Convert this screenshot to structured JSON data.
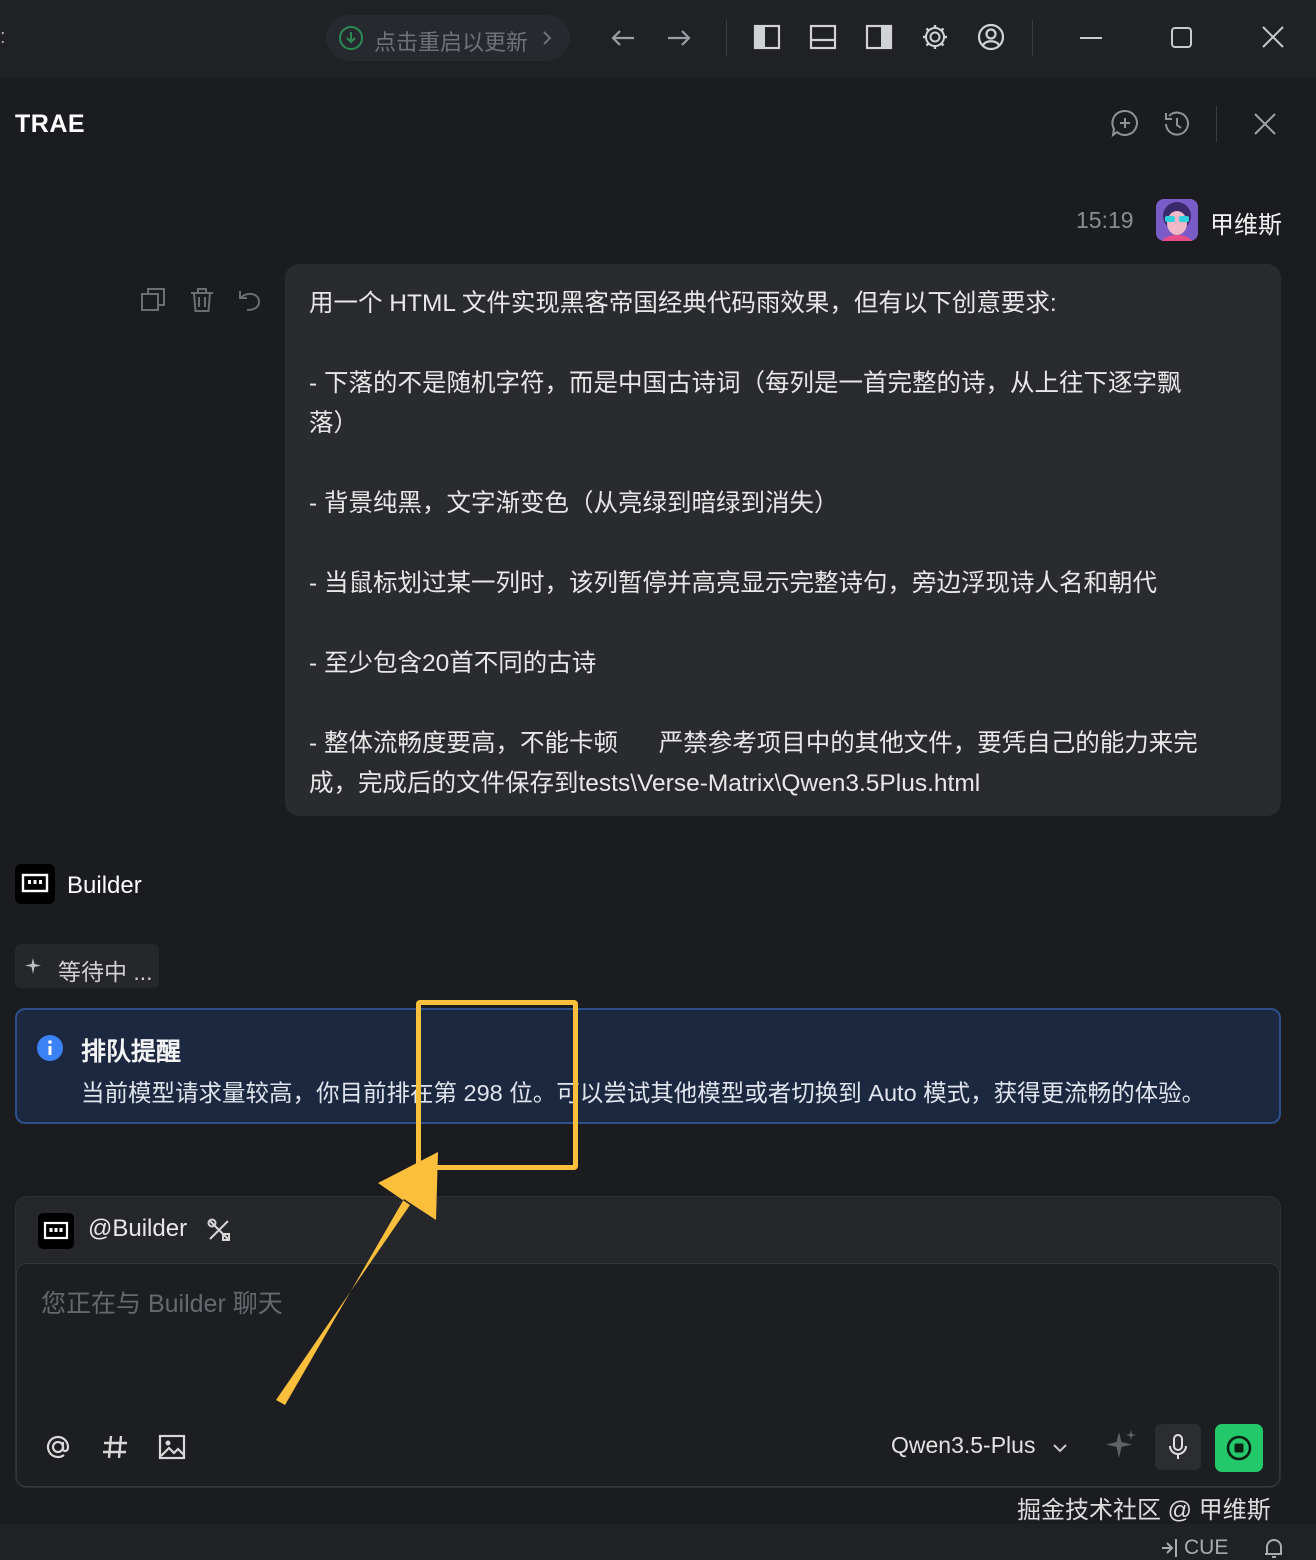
{
  "titlebar": {
    "update_label": "点击重启以更新",
    "icons": [
      "download-icon",
      "back-arrow-icon",
      "forward-arrow-icon",
      "left-panel-icon",
      "bottom-panel-icon",
      "right-panel-icon",
      "gear-icon",
      "account-icon",
      "minimize-icon",
      "maximize-icon",
      "close-icon"
    ]
  },
  "panel": {
    "title": "TRAE",
    "header_icons": [
      "new-chat-icon",
      "history-icon",
      "close-icon"
    ]
  },
  "user_message": {
    "time": "15:19",
    "user": "甲维斯",
    "actions": [
      "copy-icon",
      "delete-icon",
      "undo-icon"
    ],
    "lines": [
      "用一个 HTML 文件实现黑客帝国经典代码雨效果，但有以下创意要求:",
      "",
      "- 下落的不是随机字符，而是中国古诗词（每列是一首完整的诗，从上往下逐字飘",
      "落）",
      "",
      "- 背景纯黑，文字渐变色（从亮绿到暗绿到消失）",
      "",
      "- 当鼠标划过某一列时，该列暂停并高亮显示完整诗句，旁边浮现诗人名和朝代",
      "",
      "- 至少包含20首不同的古诗",
      "",
      "- 整体流畅度要高，不能卡顿      严禁参考项目中的其他文件，要凭自己的能力来完",
      "成，完成后的文件保存到tests\\Verse-Matrix\\Qwen3.5Plus.html"
    ]
  },
  "builder": {
    "name": "Builder",
    "status": "等待中 ...",
    "queue_title": "排队提醒",
    "queue_text": "当前模型请求量较高，你目前排在第 298 位。可以尝试其他模型或者切换到 Auto 模式，获得更流畅的体验。"
  },
  "input": {
    "agent": "@Builder",
    "placeholder": "您正在与 Builder 聊天",
    "model": "Qwen3.5-Plus",
    "tools": [
      "at-icon",
      "hash-icon",
      "image-icon"
    ]
  },
  "footer": {
    "watermark": "掘金技术社区 @ 甲维斯",
    "cue": "CUE"
  },
  "colors": {
    "background": "#1b1c1f",
    "bubble": "#2a2b2f",
    "queue_bg": "#1c2840",
    "queue_border": "#2d4f8a",
    "info_blue": "#3b82f6",
    "highlight": "#fbbf3c",
    "stop_green": "#23c86a"
  }
}
